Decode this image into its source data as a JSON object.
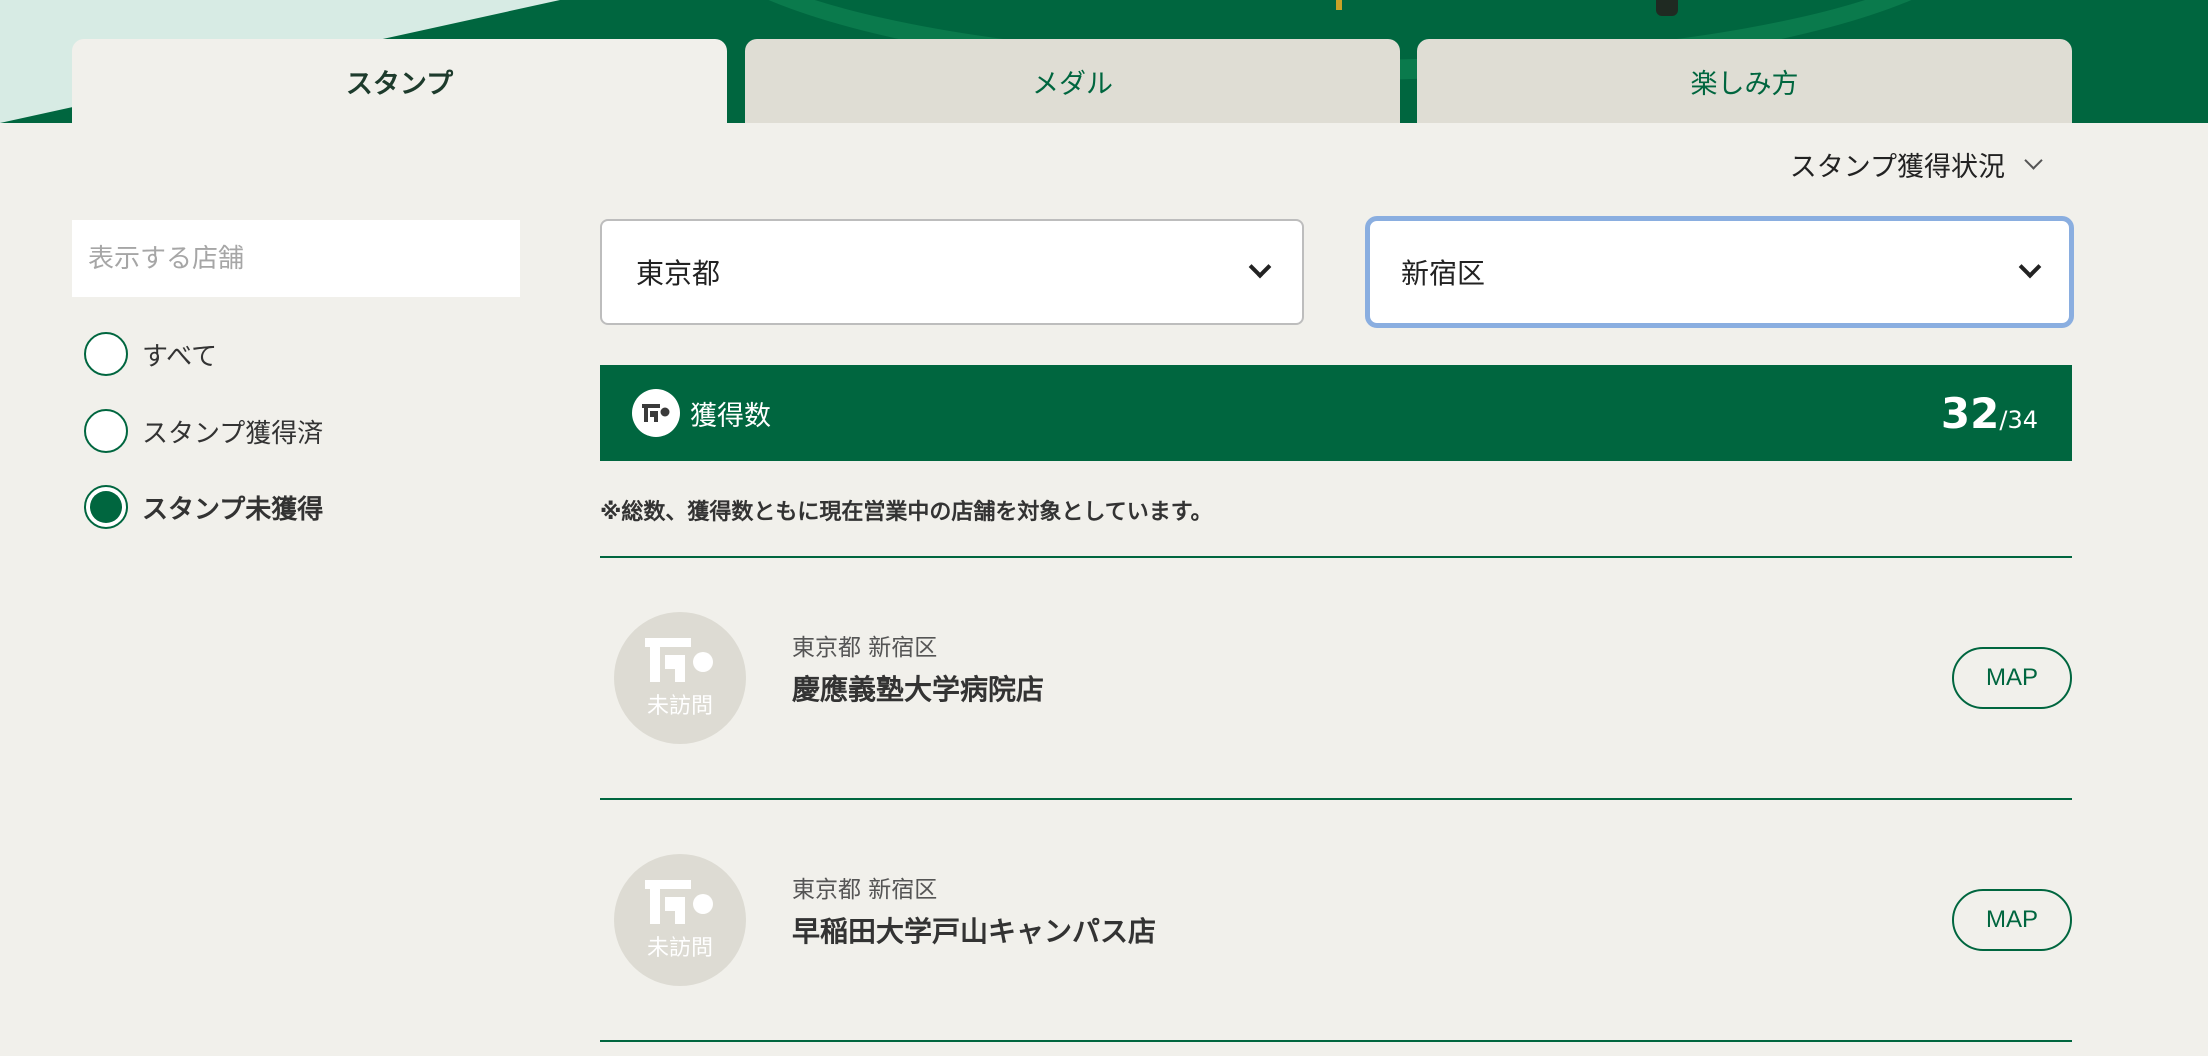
{
  "tabs": [
    {
      "label": "スタンプ",
      "active": true
    },
    {
      "label": "メダル",
      "active": false
    },
    {
      "label": "楽しみ方",
      "active": false
    }
  ],
  "status_dropdown": {
    "label": "スタンプ獲得状況"
  },
  "search": {
    "placeholder": "表示する店舗",
    "value": ""
  },
  "filters": [
    {
      "label": "すべて",
      "checked": false
    },
    {
      "label": "スタンプ獲得済",
      "checked": false
    },
    {
      "label": "スタンプ未獲得",
      "checked": true
    }
  ],
  "prefecture_select": {
    "value": "東京都"
  },
  "city_select": {
    "value": "新宿区"
  },
  "count_bar": {
    "label": "獲得数",
    "count": "32",
    "total": "/34"
  },
  "note": "※総数、獲得数ともに現在営業中の店舗を対象としています。",
  "stores": [
    {
      "area": "東京都 新宿区",
      "name": "慶應義塾大学病院店",
      "status": "未訪問",
      "map_label": "MAP"
    },
    {
      "area": "東京都 新宿区",
      "name": "早稲田大学戸山キャンパス店",
      "status": "未訪問",
      "map_label": "MAP"
    }
  ],
  "colors": {
    "brand_green": "#00663f",
    "background": "#f1f0eb",
    "focus_ring": "#8aaee0"
  }
}
